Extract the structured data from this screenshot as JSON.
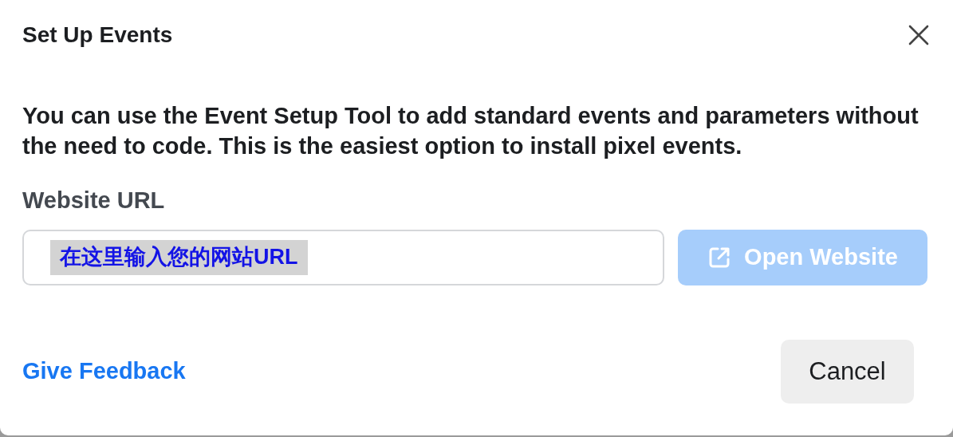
{
  "dialog": {
    "title": "Set Up Events",
    "description": "You can use the Event Setup Tool to add standard events and parameters without the need to code. This is the easiest option to install pixel events.",
    "url_field": {
      "label": "Website URL",
      "value": "在这里输入您的网站URL"
    },
    "open_button": {
      "label": "Open Website",
      "disabled": true
    },
    "feedback_link": "Give Feedback",
    "cancel_button": "Cancel"
  }
}
